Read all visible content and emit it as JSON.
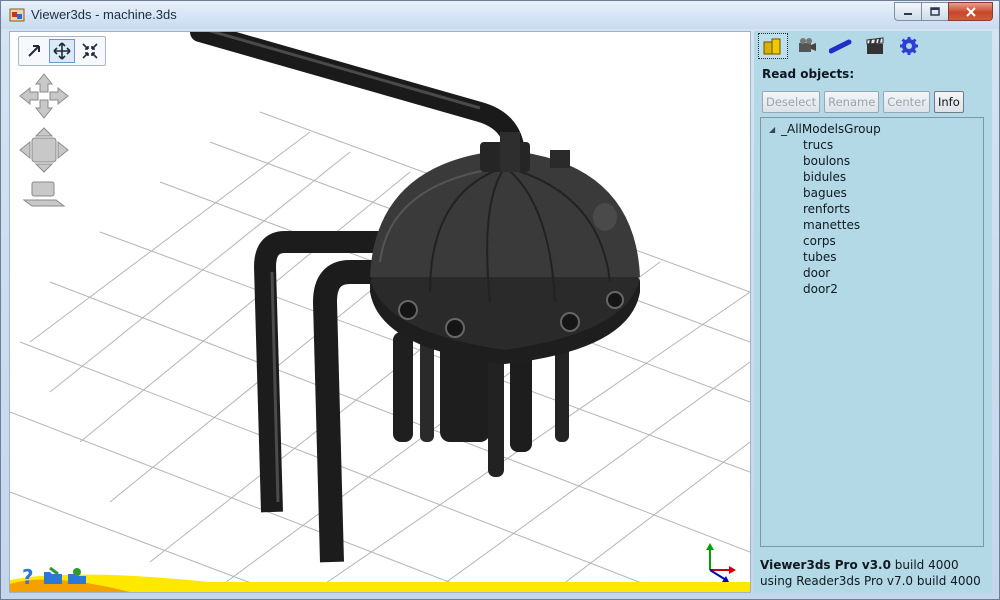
{
  "window": {
    "title": "Viewer3ds - machine.3ds"
  },
  "viewport": {
    "nav_tools": [
      {
        "name": "select-tool",
        "icon": "pointer-icon",
        "active": false
      },
      {
        "name": "pan-tool",
        "icon": "move-arrows-icon",
        "active": true
      },
      {
        "name": "zoom-extents-tool",
        "icon": "fit-arrows-icon",
        "active": false
      }
    ]
  },
  "panel": {
    "tabs": [
      {
        "name": "objects-tab",
        "icon": "objects-icon",
        "active": true
      },
      {
        "name": "camera-tab",
        "icon": "camera-icon",
        "active": false
      },
      {
        "name": "light-tab",
        "icon": "light-icon",
        "active": false
      },
      {
        "name": "animation-tab",
        "icon": "clapperboard-icon",
        "active": false
      },
      {
        "name": "settings-tab",
        "icon": "gear-icon",
        "active": false
      }
    ],
    "heading": "Read objects:",
    "buttons": {
      "deselect": "Deselect",
      "rename": "Rename",
      "center": "Center",
      "info": "Info"
    },
    "tree": {
      "root": "_AllModelsGroup",
      "items": [
        "trucs",
        "boulons",
        "bidules",
        "bagues",
        "renforts",
        "manettes",
        "corps",
        "tubes",
        "door",
        "door2"
      ]
    },
    "status": {
      "product": "Viewer3ds Pro v3.0",
      "build": " build 4000",
      "line2": "using Reader3ds Pro v7.0 build 4000"
    }
  },
  "colors": {
    "panel_bg": "#b3d9e6",
    "accent_yellow": "#ffe800",
    "axis_x": "#cc0000",
    "axis_y": "#00a000",
    "axis_z": "#0000cc"
  }
}
